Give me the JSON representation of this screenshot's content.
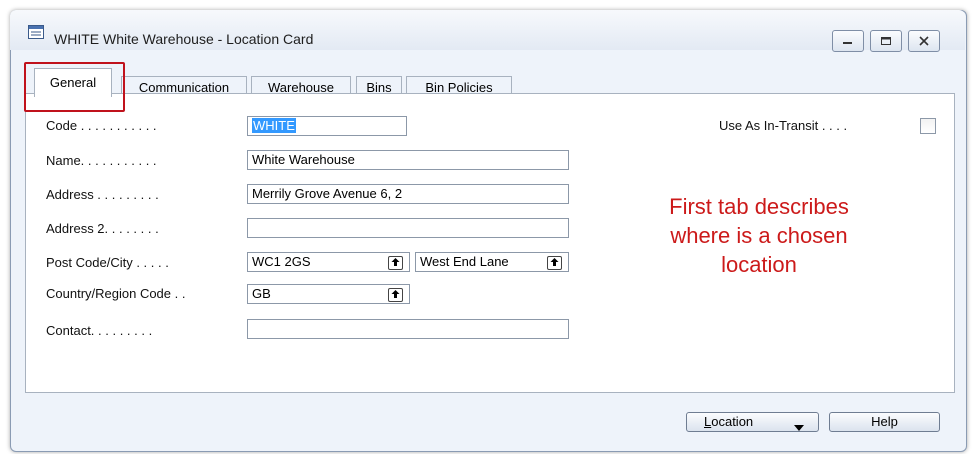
{
  "window": {
    "title": "WHITE White Warehouse - Location Card"
  },
  "tabs": [
    {
      "label": "General"
    },
    {
      "label": "Communication"
    },
    {
      "label": "Warehouse"
    },
    {
      "label": "Bins"
    },
    {
      "label": "Bin Policies"
    }
  ],
  "form": {
    "code": {
      "label": "Code . . . . . . . . . . .",
      "value": "WHITE"
    },
    "name": {
      "label": "Name. . . . . . . . . . .",
      "value": "White Warehouse"
    },
    "address": {
      "label": "Address . . . . . . . . .",
      "value": "Merrily Grove Avenue 6, 2"
    },
    "address2": {
      "label": "Address 2. . . . . . . .",
      "value": ""
    },
    "post_code_city": {
      "label": "Post Code/City . . . . .",
      "post_code": "WC1 2GS",
      "city": "West End Lane"
    },
    "country_region": {
      "label": "Country/Region Code . .",
      "value": "GB"
    },
    "contact": {
      "label": "Contact. . . . . . . . .",
      "value": ""
    },
    "use_as_in_transit": {
      "label": "Use As In-Transit . . . .",
      "checked": false
    }
  },
  "annotation": {
    "line1": "First tab describes",
    "line2": "where  is a chosen",
    "line3": "location",
    "color": "#cc1a1a"
  },
  "buttons": {
    "location_prefix": "L",
    "location_rest": "ocation",
    "help": "Help"
  },
  "icons": {
    "app": "form-icon",
    "minimize": "minimize-icon",
    "maximize": "maximize-icon",
    "close": "close-icon",
    "lookup": "lookup-arrow-icon",
    "dropdown": "triangle-down-icon"
  }
}
